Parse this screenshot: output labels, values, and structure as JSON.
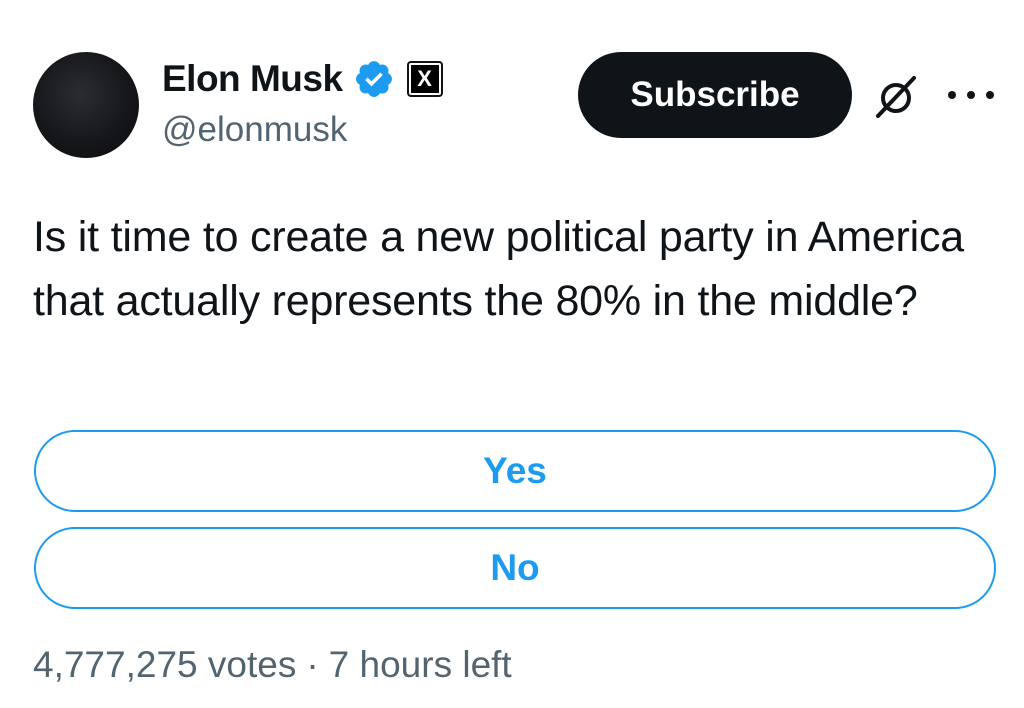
{
  "author": {
    "display_name": "Elon Musk",
    "handle": "@elonmusk",
    "verified_icon": "verified-badge-icon",
    "affiliate_badge": "X",
    "avatar": "profile-avatar"
  },
  "header_actions": {
    "subscribe_label": "Subscribe",
    "grok_icon": "grok-icon",
    "more_icon": "more-options-icon"
  },
  "tweet": {
    "text": "Is it time to create a new political party in America that actually represents the 80% in the middle?"
  },
  "poll": {
    "options": [
      {
        "label": "Yes"
      },
      {
        "label": "No"
      }
    ],
    "votes": "4,777,275 votes",
    "separator": "·",
    "time_left": "7 hours left"
  },
  "colors": {
    "accent": "#1d9bf0",
    "text_primary": "#0f1419",
    "text_secondary": "#536471",
    "button_dark": "#0f1419"
  }
}
